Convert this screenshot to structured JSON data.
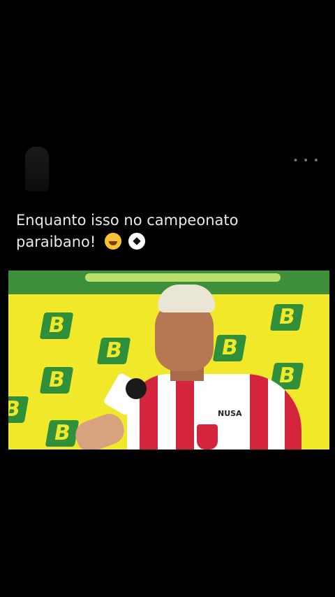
{
  "tweet": {
    "text_line1": "Enquanto isso no campeonato",
    "text_line2": "paraibano!",
    "more_icon": "more-options-icon",
    "emojis": [
      "face-with-tears-of-joy",
      "soccer-ball"
    ]
  },
  "media": {
    "sponsor_text": "NUSA",
    "logo_letter": "B"
  },
  "colors": {
    "background": "#000000",
    "text": "#e7e9ea",
    "backdrop": "#f2e82a",
    "logo": "#2f8f3b",
    "jersey_red": "#d5253d"
  }
}
